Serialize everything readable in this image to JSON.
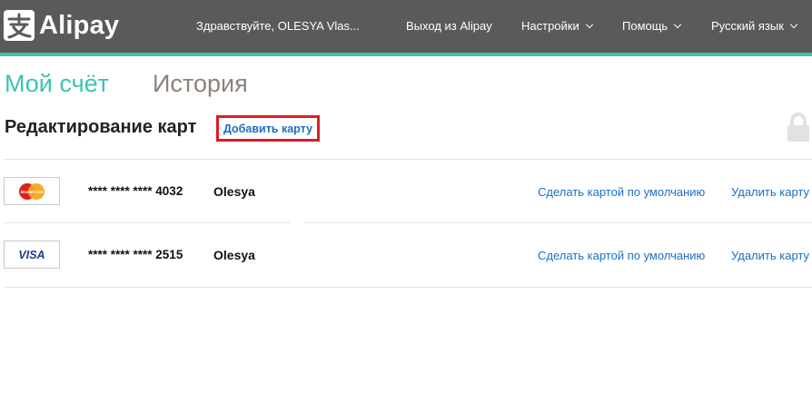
{
  "header": {
    "logo_text": "Alipay",
    "greeting": "Здравствуйте, OLESYA Vlas...",
    "logout": "Выход из Alipay",
    "settings": "Настройки",
    "help": "Помощь",
    "language": "Русский язык"
  },
  "tabs": {
    "my_account": "Мой счёт",
    "history": "История"
  },
  "section": {
    "title": "Редактирование карт",
    "add_card": "Добавить карту"
  },
  "cards": [
    {
      "brand": "MasterCard",
      "brand_icon": "mastercard-icon",
      "number": "**** **** **** 4032",
      "owner": "Olesya",
      "set_default": "Сделать картой по умолчанию",
      "delete": "Удалить карту"
    },
    {
      "brand": "VISA",
      "brand_icon": "visa-icon",
      "number": "**** **** **** 2515",
      "owner": "Olesya",
      "set_default": "Сделать картой по умолчанию",
      "delete": "Удалить карту"
    }
  ],
  "colors": {
    "header_bg": "#5a5a5a",
    "accent": "#3cc3b5",
    "link": "#1a6fc4",
    "highlight_border": "#e01b24"
  }
}
